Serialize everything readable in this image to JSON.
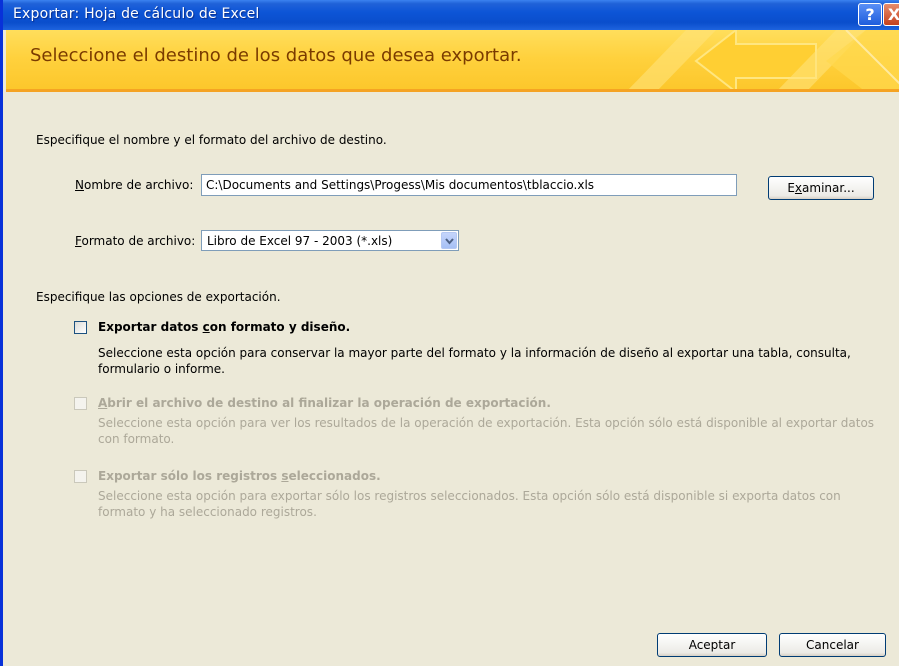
{
  "window": {
    "title": "Exportar: Hoja de cálculo de Excel",
    "help_glyph": "?",
    "close_glyph": "X"
  },
  "banner": {
    "text": "Seleccione el destino de los datos que desea exportar."
  },
  "destination": {
    "instructions": "Especifique el nombre y el formato del archivo de destino.",
    "filename_label": "Nombre de archivo:",
    "filename_value": "C:\\Documents and Settings\\Progess\\Mis documentos\\tblaccio.xls",
    "browse_label": "Examinar...",
    "format_label": "Formato de archivo:",
    "format_value": "Libro de Excel 97 - 2003 (*.xls)"
  },
  "options": {
    "instructions": "Especifique las opciones de exportación.",
    "items": [
      {
        "title": "Exportar datos con formato y diseño.",
        "description": "Seleccione esta opción para conservar la mayor parte del formato y la información de diseño al exportar una tabla, consulta, formulario o informe.",
        "checked": false,
        "enabled": true
      },
      {
        "title": "Abrir el archivo de destino al finalizar la operación de exportación.",
        "description": "Seleccione esta opción para ver los resultados de la operación de exportación. Esta opción sólo está disponible al exportar datos con formato.",
        "checked": false,
        "enabled": false
      },
      {
        "title": "Exportar sólo los registros seleccionados.",
        "description": "Seleccione esta opción para exportar sólo los registros seleccionados. Esta opción sólo está disponible si exporta datos con formato y ha seleccionado registros.",
        "checked": false,
        "enabled": false
      }
    ]
  },
  "footer": {
    "ok_label": "Aceptar",
    "cancel_label": "Cancelar"
  },
  "colors": {
    "titlebar": "#0a4ecc",
    "banner": "#ffd13d",
    "banner_text": "#7a3b00",
    "dialog_bg": "#ece9d8",
    "disabled_text": "#aca899"
  }
}
